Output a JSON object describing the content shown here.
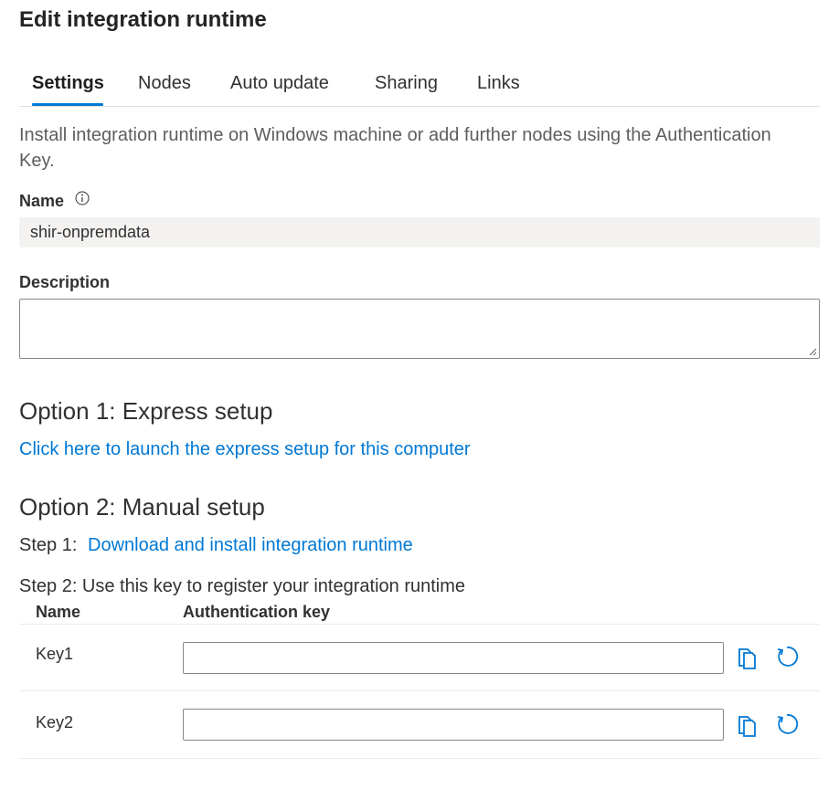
{
  "panel": {
    "title": "Edit integration runtime"
  },
  "tabs": [
    {
      "label": "Settings",
      "active": true
    },
    {
      "label": "Nodes"
    },
    {
      "label": "Auto update"
    },
    {
      "label": "Sharing"
    },
    {
      "label": "Links"
    }
  ],
  "settings": {
    "intro": "Install integration runtime on Windows machine or add further nodes using the Authentication Key.",
    "name_label": "Name",
    "name_value": "shir-onpremdata",
    "description_label": "Description",
    "description_value": "",
    "option1_title": "Option 1: Express setup",
    "option1_link": "Click here to launch the express setup for this computer",
    "option2_title": "Option 2: Manual setup",
    "step1_label": "Step 1:",
    "step1_link": "Download and install integration runtime",
    "step2_text": "Step 2: Use this key to register your integration runtime",
    "keys_table": {
      "columns": [
        "Name",
        "Authentication key"
      ],
      "rows": [
        {
          "name": "Key1",
          "value": ""
        },
        {
          "name": "Key2",
          "value": ""
        }
      ]
    }
  },
  "colors": {
    "accent": "#0078d4",
    "text": "#323130",
    "muted": "#605e5c",
    "field_bg": "#f3f2f1"
  },
  "icons": [
    "info-icon",
    "copy-icon",
    "refresh-icon",
    "resize-grip-icon"
  ]
}
